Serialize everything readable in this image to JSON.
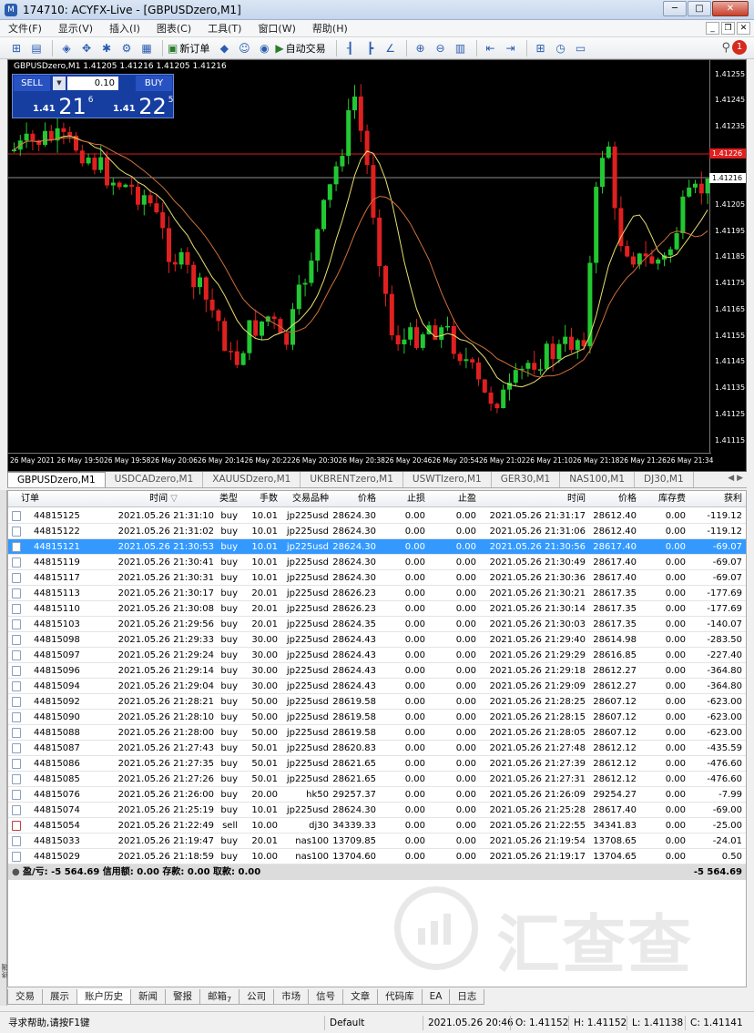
{
  "window": {
    "title": "174710: ACYFX-Live - [GBPUSDzero,M1]"
  },
  "menu": [
    "文件(F)",
    "显示(V)",
    "插入(I)",
    "图表(C)",
    "工具(T)",
    "窗口(W)",
    "帮助(H)"
  ],
  "toolbar": {
    "new_order": "新订单",
    "auto_trading": "自动交易",
    "alert_count": "1"
  },
  "chart": {
    "symbol_info": "GBPUSDzero,M1  1.41205 1.41216 1.41205 1.41216",
    "oneclick": {
      "sell_label": "SELL",
      "buy_label": "BUY",
      "lot": "0.10",
      "sell_prefix": "1.41",
      "sell_big": "21",
      "sell_sup": "6",
      "buy_prefix": "1.41",
      "buy_big": "22",
      "buy_sup": "5"
    },
    "price_ticks": [
      "1.41255",
      "1.41245",
      "1.41235",
      "1.41225",
      "1.41205",
      "1.41195",
      "1.41185",
      "1.41175",
      "1.41165",
      "1.41155",
      "1.41145",
      "1.41135",
      "1.41125",
      "1.41115"
    ],
    "red_line_price": "1.41226",
    "current_price": "1.41216",
    "time_ticks": [
      "26 May 2021",
      "26 May 19:50",
      "26 May 19:58",
      "26 May 20:06",
      "26 May 20:14",
      "26 May 20:22",
      "26 May 20:30",
      "26 May 20:38",
      "26 May 20:46",
      "26 May 20:54",
      "26 May 21:02",
      "26 May 21:10",
      "26 May 21:18",
      "26 May 21:26",
      "26 May 21:34"
    ]
  },
  "chart_tabs": [
    "GBPUSDzero,M1",
    "USDCADzero,M1",
    "XAUUSDzero,M1",
    "UKBRENTzero,M1",
    "USWTIzero,M1",
    "GER30,M1",
    "NAS100,M1",
    "DJ30,M1"
  ],
  "terminal": {
    "headers": {
      "order": "订单",
      "open_time": "时间",
      "type": "类型",
      "lots": "手数",
      "symbol": "交易品种",
      "open_price": "价格",
      "sl": "止损",
      "tp": "止盈",
      "close_time": "时间",
      "close_price": "价格",
      "swap": "库存费",
      "profit": "获利"
    },
    "rows": [
      [
        "44815125",
        "2021.05.26 21:31:10",
        "buy",
        "10.01",
        "jp225usd",
        "28624.30",
        "0.00",
        "0.00",
        "2021.05.26 21:31:17",
        "28612.40",
        "0.00",
        "-119.12"
      ],
      [
        "44815122",
        "2021.05.26 21:31:02",
        "buy",
        "10.01",
        "jp225usd",
        "28624.30",
        "0.00",
        "0.00",
        "2021.05.26 21:31:06",
        "28612.40",
        "0.00",
        "-119.12"
      ],
      [
        "44815121",
        "2021.05.26 21:30:53",
        "buy",
        "10.01",
        "jp225usd",
        "28624.30",
        "0.00",
        "0.00",
        "2021.05.26 21:30:56",
        "28617.40",
        "0.00",
        "-69.07"
      ],
      [
        "44815119",
        "2021.05.26 21:30:41",
        "buy",
        "10.01",
        "jp225usd",
        "28624.30",
        "0.00",
        "0.00",
        "2021.05.26 21:30:49",
        "28617.40",
        "0.00",
        "-69.07"
      ],
      [
        "44815117",
        "2021.05.26 21:30:31",
        "buy",
        "10.01",
        "jp225usd",
        "28624.30",
        "0.00",
        "0.00",
        "2021.05.26 21:30:36",
        "28617.40",
        "0.00",
        "-69.07"
      ],
      [
        "44815113",
        "2021.05.26 21:30:17",
        "buy",
        "20.01",
        "jp225usd",
        "28626.23",
        "0.00",
        "0.00",
        "2021.05.26 21:30:21",
        "28617.35",
        "0.00",
        "-177.69"
      ],
      [
        "44815110",
        "2021.05.26 21:30:08",
        "buy",
        "20.01",
        "jp225usd",
        "28626.23",
        "0.00",
        "0.00",
        "2021.05.26 21:30:14",
        "28617.35",
        "0.00",
        "-177.69"
      ],
      [
        "44815103",
        "2021.05.26 21:29:56",
        "buy",
        "20.01",
        "jp225usd",
        "28624.35",
        "0.00",
        "0.00",
        "2021.05.26 21:30:03",
        "28617.35",
        "0.00",
        "-140.07"
      ],
      [
        "44815098",
        "2021.05.26 21:29:33",
        "buy",
        "30.00",
        "jp225usd",
        "28624.43",
        "0.00",
        "0.00",
        "2021.05.26 21:29:40",
        "28614.98",
        "0.00",
        "-283.50"
      ],
      [
        "44815097",
        "2021.05.26 21:29:24",
        "buy",
        "30.00",
        "jp225usd",
        "28624.43",
        "0.00",
        "0.00",
        "2021.05.26 21:29:29",
        "28616.85",
        "0.00",
        "-227.40"
      ],
      [
        "44815096",
        "2021.05.26 21:29:14",
        "buy",
        "30.00",
        "jp225usd",
        "28624.43",
        "0.00",
        "0.00",
        "2021.05.26 21:29:18",
        "28612.27",
        "0.00",
        "-364.80"
      ],
      [
        "44815094",
        "2021.05.26 21:29:04",
        "buy",
        "30.00",
        "jp225usd",
        "28624.43",
        "0.00",
        "0.00",
        "2021.05.26 21:29:09",
        "28612.27",
        "0.00",
        "-364.80"
      ],
      [
        "44815092",
        "2021.05.26 21:28:21",
        "buy",
        "50.00",
        "jp225usd",
        "28619.58",
        "0.00",
        "0.00",
        "2021.05.26 21:28:25",
        "28607.12",
        "0.00",
        "-623.00"
      ],
      [
        "44815090",
        "2021.05.26 21:28:10",
        "buy",
        "50.00",
        "jp225usd",
        "28619.58",
        "0.00",
        "0.00",
        "2021.05.26 21:28:15",
        "28607.12",
        "0.00",
        "-623.00"
      ],
      [
        "44815088",
        "2021.05.26 21:28:00",
        "buy",
        "50.00",
        "jp225usd",
        "28619.58",
        "0.00",
        "0.00",
        "2021.05.26 21:28:05",
        "28607.12",
        "0.00",
        "-623.00"
      ],
      [
        "44815087",
        "2021.05.26 21:27:43",
        "buy",
        "50.01",
        "jp225usd",
        "28620.83",
        "0.00",
        "0.00",
        "2021.05.26 21:27:48",
        "28612.12",
        "0.00",
        "-435.59"
      ],
      [
        "44815086",
        "2021.05.26 21:27:35",
        "buy",
        "50.01",
        "jp225usd",
        "28621.65",
        "0.00",
        "0.00",
        "2021.05.26 21:27:39",
        "28612.12",
        "0.00",
        "-476.60"
      ],
      [
        "44815085",
        "2021.05.26 21:27:26",
        "buy",
        "50.01",
        "jp225usd",
        "28621.65",
        "0.00",
        "0.00",
        "2021.05.26 21:27:31",
        "28612.12",
        "0.00",
        "-476.60"
      ],
      [
        "44815076",
        "2021.05.26 21:26:00",
        "buy",
        "20.00",
        "hk50",
        "29257.37",
        "0.00",
        "0.00",
        "2021.05.26 21:26:09",
        "29254.27",
        "0.00",
        "-7.99"
      ],
      [
        "44815074",
        "2021.05.26 21:25:19",
        "buy",
        "10.01",
        "jp225usd",
        "28624.30",
        "0.00",
        "0.00",
        "2021.05.26 21:25:28",
        "28617.40",
        "0.00",
        "-69.00"
      ],
      [
        "44815054",
        "2021.05.26 21:22:49",
        "sell",
        "10.00",
        "dj30",
        "34339.33",
        "0.00",
        "0.00",
        "2021.05.26 21:22:55",
        "34341.83",
        "0.00",
        "-25.00"
      ],
      [
        "44815033",
        "2021.05.26 21:19:47",
        "buy",
        "20.01",
        "nas100",
        "13709.85",
        "0.00",
        "0.00",
        "2021.05.26 21:19:54",
        "13708.65",
        "0.00",
        "-24.01"
      ],
      [
        "44815029",
        "2021.05.26 21:18:59",
        "buy",
        "10.00",
        "nas100",
        "13704.60",
        "0.00",
        "0.00",
        "2021.05.26 21:19:17",
        "13704.65",
        "0.00",
        "0.50"
      ]
    ],
    "selected_row": 2,
    "summary": {
      "text": "盈/亏: -5 564.69  信用额: 0.00  存款: 0.00  取款: 0.00",
      "total": "-5 564.69"
    },
    "side_label": "终端"
  },
  "watermark": {
    "text": "汇查查"
  },
  "bottom_tabs": [
    "交易",
    "展示",
    "账户历史",
    "新闻",
    "警报",
    "邮箱",
    "公司",
    "市场",
    "信号",
    "文章",
    "代码库",
    "EA",
    "日志"
  ],
  "bottom_tabs_mail_count": "7",
  "active_bottom_tab": 2,
  "status": {
    "help": "寻求帮助,请按F1键",
    "profile": "Default",
    "datetime": "2021.05.26 20:46",
    "open": "O: 1.41152",
    "high": "H: 1.41152",
    "low": "L: 1.41138",
    "close": "C: 1.41141"
  },
  "colors": {
    "bull": "#22c832",
    "bear": "#e02020",
    "ma_fast": "#e8e070",
    "ma_slow": "#d0703a",
    "selection": "#3399ff"
  }
}
